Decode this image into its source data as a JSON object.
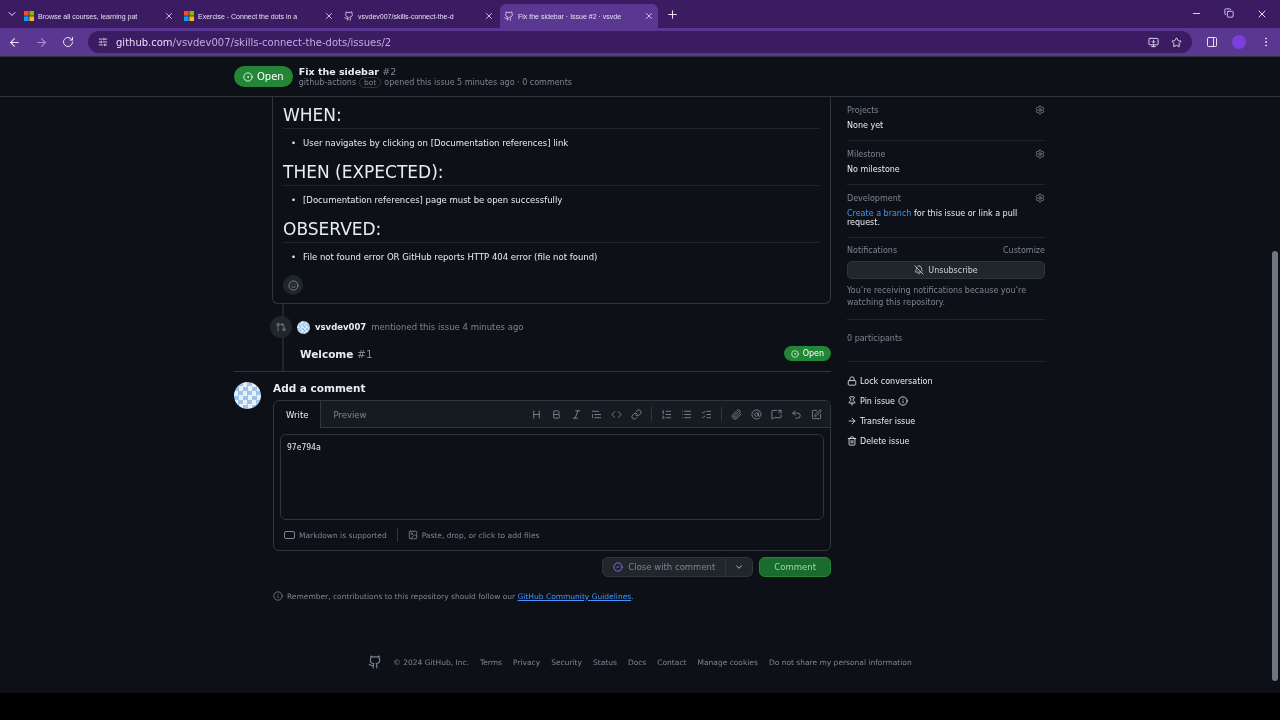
{
  "browser": {
    "tabs": [
      {
        "title": "Browse all courses, learning pat",
        "kind": "microsoft",
        "selected": false
      },
      {
        "title": "Exercise - Connect the dots in a",
        "kind": "microsoft",
        "selected": false
      },
      {
        "title": "vsvdev007/skills-connect-the-d",
        "kind": "github",
        "selected": false
      },
      {
        "title": "Fix the sidebar · Issue #2 · vsvde",
        "kind": "github",
        "selected": true
      }
    ],
    "url_host": "github.com",
    "url_path": "/vsvdev007/skills-connect-the-dots/issues/2"
  },
  "issue_header": {
    "state": "Open",
    "title": "Fix the sidebar",
    "number": "#2",
    "author": "github-actions",
    "author_label": "bot",
    "meta": "opened this issue 5 minutes ago · 0 comments"
  },
  "body": {
    "sections": [
      {
        "heading": "WHEN:",
        "bullet": "•",
        "items": [
          "User navigates by clicking on [Documentation references] link"
        ]
      },
      {
        "heading": "THEN (EXPECTED):",
        "bullet": "•",
        "items": [
          "[Documentation references] page must be open successfully"
        ]
      },
      {
        "heading": "OBSERVED:",
        "bullet": "•",
        "items": [
          "File not found error OR GitHub reports HTTP 404 error (file not found)"
        ]
      }
    ]
  },
  "event": {
    "user": "vsvdev007",
    "action": "mentioned this issue 4 minutes ago",
    "ref_title": "Welcome",
    "ref_number": "#1",
    "state": "Open"
  },
  "comment_form": {
    "title": "Add a comment",
    "tabs": [
      {
        "label": "Write",
        "selected": true
      },
      {
        "label": "Preview",
        "selected": false
      }
    ],
    "value": "97e794a",
    "markdown_note": "Markdown is supported",
    "attach_note": "Paste, drop, or click to add files",
    "close_button": "Close with comment",
    "comment_button": "Comment"
  },
  "guidelines": {
    "text": "Remember, contributions to this repository should follow our",
    "link": "GitHub Community Guidelines",
    "end": "."
  },
  "sidebar": {
    "projects": {
      "label": "Projects",
      "value": "None yet"
    },
    "milestone": {
      "label": "Milestone",
      "value": "No milestone"
    },
    "development": {
      "label": "Development",
      "link": "Create a branch",
      "text": "for this issue or link a pull request."
    },
    "notifications": {
      "label": "Notifications",
      "customize": "Customize",
      "button": "Unsubscribe",
      "note": "You’re receiving notifications because you’re watching this repository."
    },
    "participants": "0 participants",
    "actions": [
      {
        "kind": "lock",
        "label": "Lock conversation"
      },
      {
        "kind": "pin",
        "label": "Pin issue"
      },
      {
        "kind": "transfer",
        "label": "Transfer issue"
      },
      {
        "kind": "delete",
        "label": "Delete issue"
      }
    ]
  },
  "footer": {
    "copyright": "© 2024 GitHub, Inc.",
    "links": [
      "Terms",
      "Privacy",
      "Security",
      "Status",
      "Docs",
      "Contact",
      "Manage cookies",
      "Do not share my personal information"
    ]
  }
}
